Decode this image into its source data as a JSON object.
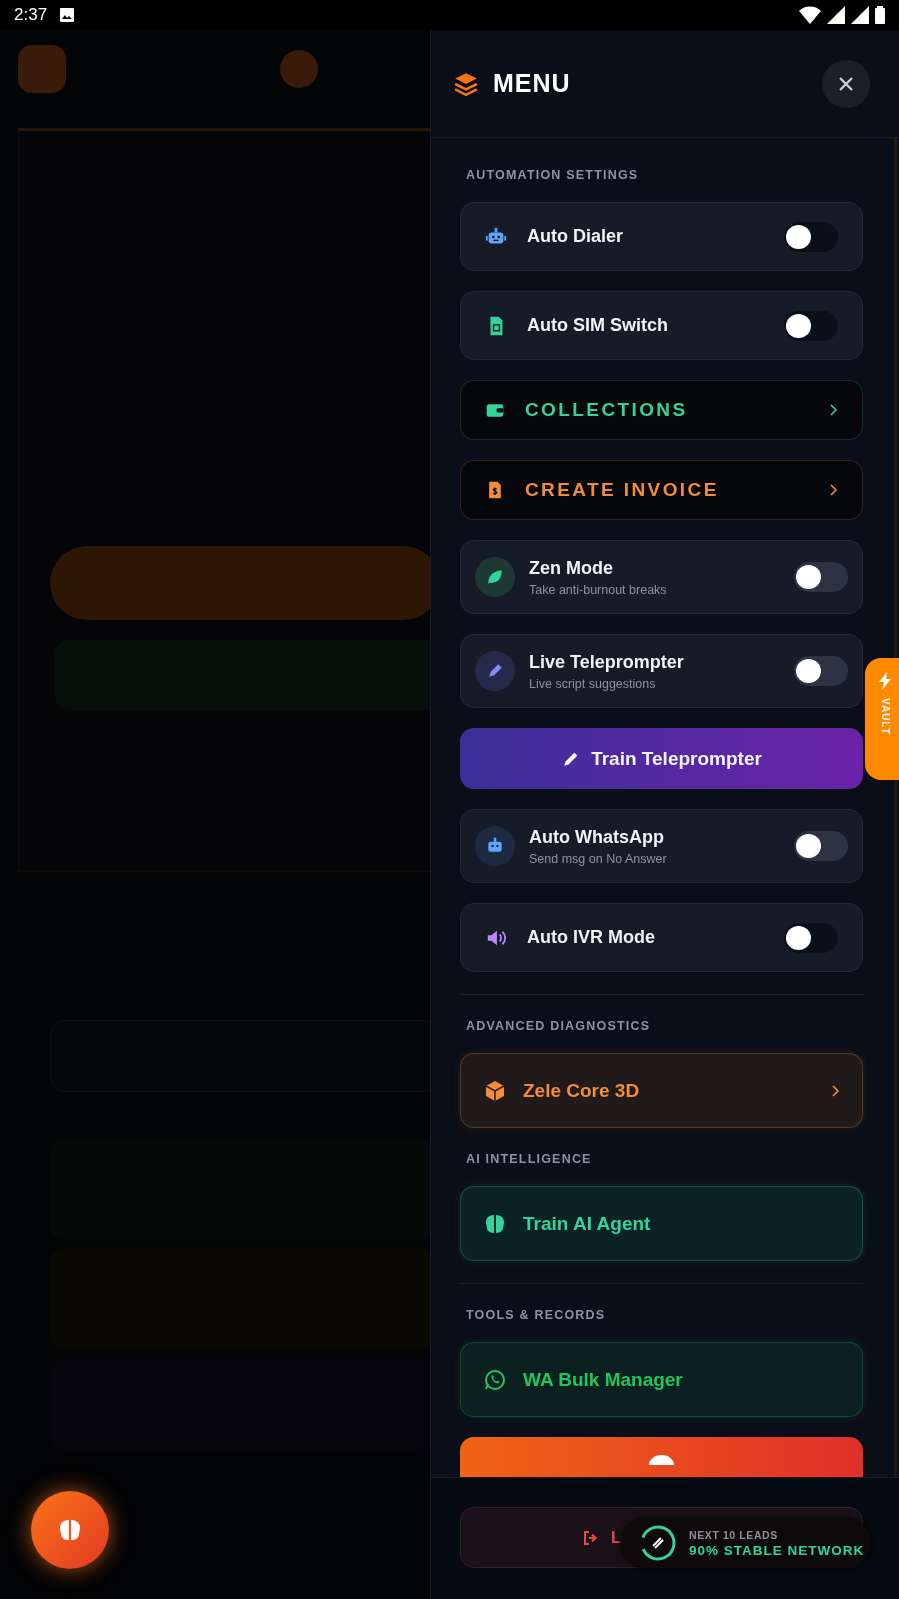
{
  "status_bar": {
    "time": "2:37"
  },
  "menu": {
    "title": "MENU",
    "sections": [
      {
        "title": "AUTOMATION SETTINGS",
        "divider": false,
        "items": [
          {
            "kind": "toggle",
            "label": "Auto Dialer",
            "on": false
          },
          {
            "kind": "toggle",
            "label": "Auto SIM Switch",
            "on": false
          },
          {
            "kind": "link",
            "label": "COLLECTIONS",
            "color": "#34d399"
          },
          {
            "kind": "link",
            "label": "CREATE INVOICE",
            "color": "#f28c38"
          },
          {
            "kind": "toggle_detail",
            "label": "Zen Mode",
            "subtitle": "Take anti-burnout breaks",
            "on": false
          },
          {
            "kind": "toggle_detail",
            "label": "Live Teleprompter",
            "subtitle": "Live script suggestions",
            "on": false
          },
          {
            "kind": "action",
            "label": "Train Teleprompter"
          },
          {
            "kind": "toggle_detail",
            "label": "Auto WhatsApp",
            "subtitle": "Send msg on No Answer",
            "on": false
          },
          {
            "kind": "toggle",
            "label": "Auto IVR Mode",
            "on": false
          }
        ]
      },
      {
        "title": "ADVANCED DIAGNOSTICS",
        "divider": true,
        "items": [
          {
            "kind": "tile",
            "label": "Zele Core 3D",
            "color": "#f28c38",
            "arrow": true
          }
        ]
      },
      {
        "title": "AI INTELLIGENCE",
        "divider": false,
        "items": [
          {
            "kind": "tile",
            "label": "Train AI Agent",
            "color": "#34d399",
            "arrow": false
          }
        ]
      },
      {
        "title": "TOOLS & RECORDS",
        "divider": true,
        "items": [
          {
            "kind": "tile",
            "label": "WA Bulk Manager",
            "color": "#22c55e",
            "arrow": false
          },
          {
            "kind": "banner"
          }
        ]
      }
    ],
    "logout": {
      "label": "L"
    },
    "network": {
      "caption": "NEXT 10 LEADS",
      "status": "90% STABLE NETWORK"
    }
  },
  "vault": {
    "label": "VAULT"
  }
}
